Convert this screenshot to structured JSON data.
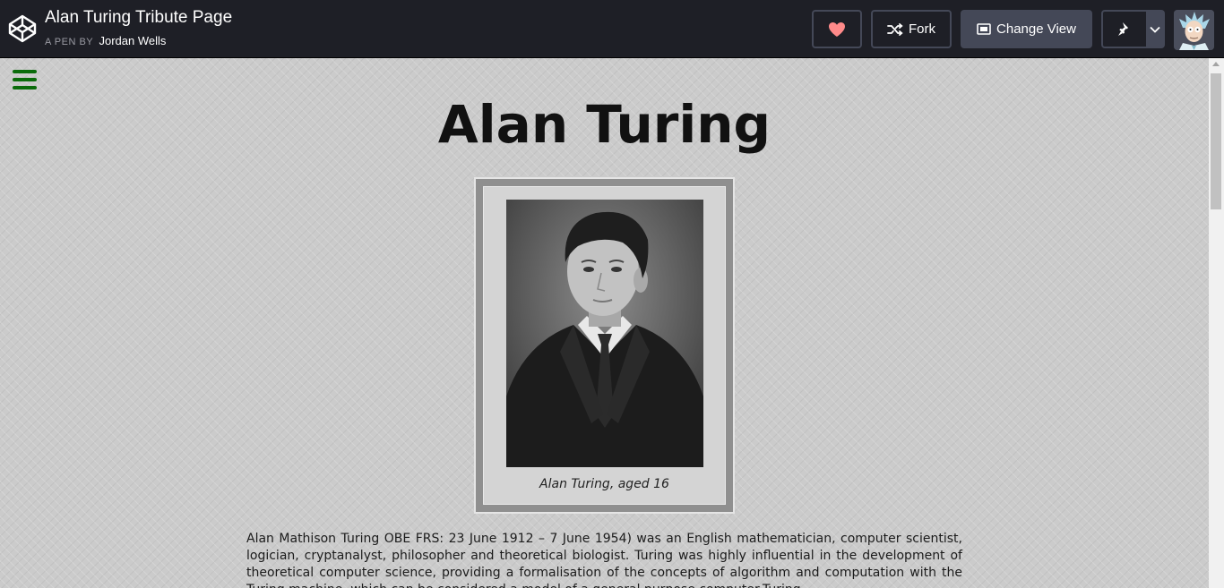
{
  "header": {
    "pen_title": "Alan Turing Tribute Page",
    "by_label": "A PEN BY",
    "author": "Jordan Wells",
    "fork_label": "Fork",
    "change_view_label": "Change View"
  },
  "page": {
    "title": "Alan Turing",
    "caption": "Alan Turing, aged 16",
    "bio": "Alan Mathison Turing OBE FRS: 23 June 1912 – 7 June 1954) was an English mathematician, computer scientist, logician, cryptanalyst, philosopher and theoretical biologist. Turing was highly influential in the development of theoretical computer science, providing a formalisation of the concepts of algorithm and computation with the Turing machine, which can be considered a model of a general purpose computer.Turing"
  },
  "colors": {
    "topbar": "#1e1f26",
    "button_border": "#444857",
    "heart": "#ff8a8a",
    "menu_icon": "#0a6b0a"
  },
  "icons": [
    "codepen-logo-icon",
    "heart-icon",
    "fork-icon",
    "change-view-icon",
    "pin-icon",
    "chevron-down-icon",
    "hamburger-menu-icon"
  ]
}
